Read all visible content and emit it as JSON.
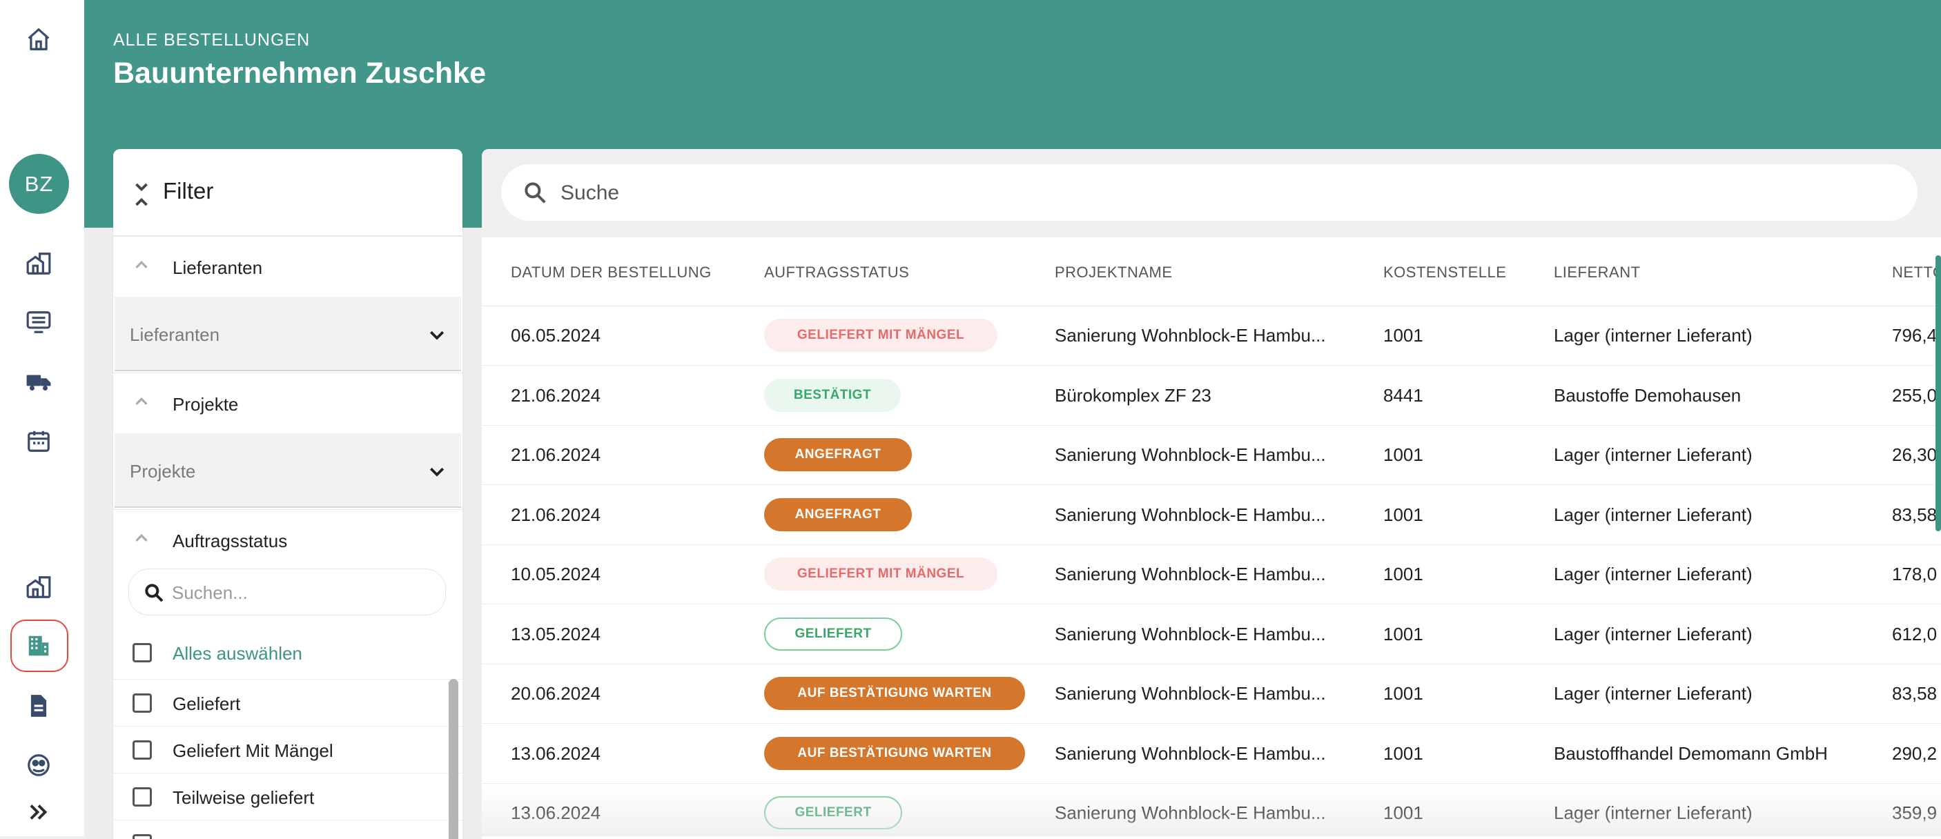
{
  "sidebar": {
    "avatar_initials": "BZ",
    "icons": [
      "home-icon",
      "buildings-icon",
      "list-icon",
      "truck-icon",
      "calendar-icon",
      "buildings-alt-icon",
      "office-building-icon",
      "document-icon",
      "support-icon",
      "expand-icon"
    ],
    "active_item": "office-building-icon"
  },
  "header": {
    "eyebrow": "ALLE BESTELLUNGEN",
    "title": "Bauunternehmen Zuschke"
  },
  "filter": {
    "title": "Filter",
    "sections": [
      {
        "title": "Lieferanten",
        "select_placeholder": "Lieferanten"
      },
      {
        "title": "Projekte",
        "select_placeholder": "Projekte"
      },
      {
        "title": "Auftragsstatus"
      }
    ],
    "status_search_placeholder": "Suchen...",
    "select_all_label": "Alles auswählen",
    "status_options": [
      "Geliefert",
      "Geliefert Mit Mängel",
      "Teilweise geliefert"
    ]
  },
  "search": {
    "placeholder": "Suche"
  },
  "table": {
    "columns": [
      "DATUM DER BESTELLUNG",
      "AUFTRAGSSTATUS",
      "PROJEKTNAME",
      "KOSTENSTELLE",
      "LIEFERANT",
      "NETTO"
    ],
    "rows": [
      {
        "date": "06.05.2024",
        "status": "GELIEFERT MIT MÄNGEL",
        "status_type": "maengel",
        "project": "Sanierung Wohnblock-E Hambu...",
        "cost_center": "1001",
        "supplier": "Lager (interner Lieferant)",
        "net": "796,4"
      },
      {
        "date": "21.06.2024",
        "status": "BESTÄTIGT",
        "status_type": "bestaetigt",
        "project": "Bürokomplex ZF 23",
        "cost_center": "8441",
        "supplier": "Baustoffe Demohausen",
        "net": "255,0"
      },
      {
        "date": "21.06.2024",
        "status": "ANGEFRAGT",
        "status_type": "angefragt",
        "project": "Sanierung Wohnblock-E Hambu...",
        "cost_center": "1001",
        "supplier": "Lager (interner Lieferant)",
        "net": "26,30"
      },
      {
        "date": "21.06.2024",
        "status": "ANGEFRAGT",
        "status_type": "angefragt",
        "project": "Sanierung Wohnblock-E Hambu...",
        "cost_center": "1001",
        "supplier": "Lager (interner Lieferant)",
        "net": "83,58"
      },
      {
        "date": "10.05.2024",
        "status": "GELIEFERT MIT MÄNGEL",
        "status_type": "maengel",
        "project": "Sanierung Wohnblock-E Hambu...",
        "cost_center": "1001",
        "supplier": "Lager (interner Lieferant)",
        "net": "178,0"
      },
      {
        "date": "13.05.2024",
        "status": "GELIEFERT",
        "status_type": "geliefert",
        "project": "Sanierung Wohnblock-E Hambu...",
        "cost_center": "1001",
        "supplier": "Lager (interner Lieferant)",
        "net": "612,0"
      },
      {
        "date": "20.06.2024",
        "status": "AUF BESTÄTIGUNG WARTEN",
        "status_type": "warten",
        "project": "Sanierung Wohnblock-E Hambu...",
        "cost_center": "1001",
        "supplier": "Lager (interner Lieferant)",
        "net": "83,58"
      },
      {
        "date": "13.06.2024",
        "status": "AUF BESTÄTIGUNG WARTEN",
        "status_type": "warten",
        "project": "Sanierung Wohnblock-E Hambu...",
        "cost_center": "1001",
        "supplier": "Baustoffhandel Demomann GmbH",
        "net": "290,2"
      },
      {
        "date": "13.06.2024",
        "status": "GELIEFERT",
        "status_type": "geliefert",
        "project": "Sanierung Wohnblock-E Hambu...",
        "cost_center": "1001",
        "supplier": "Lager (interner Lieferant)",
        "net": "359,9"
      }
    ]
  },
  "colors": {
    "brand": "#43968a",
    "accent": "#3e9585",
    "warning": "#d4772c",
    "danger": "#e56a6a",
    "success": "#3aa76a"
  }
}
